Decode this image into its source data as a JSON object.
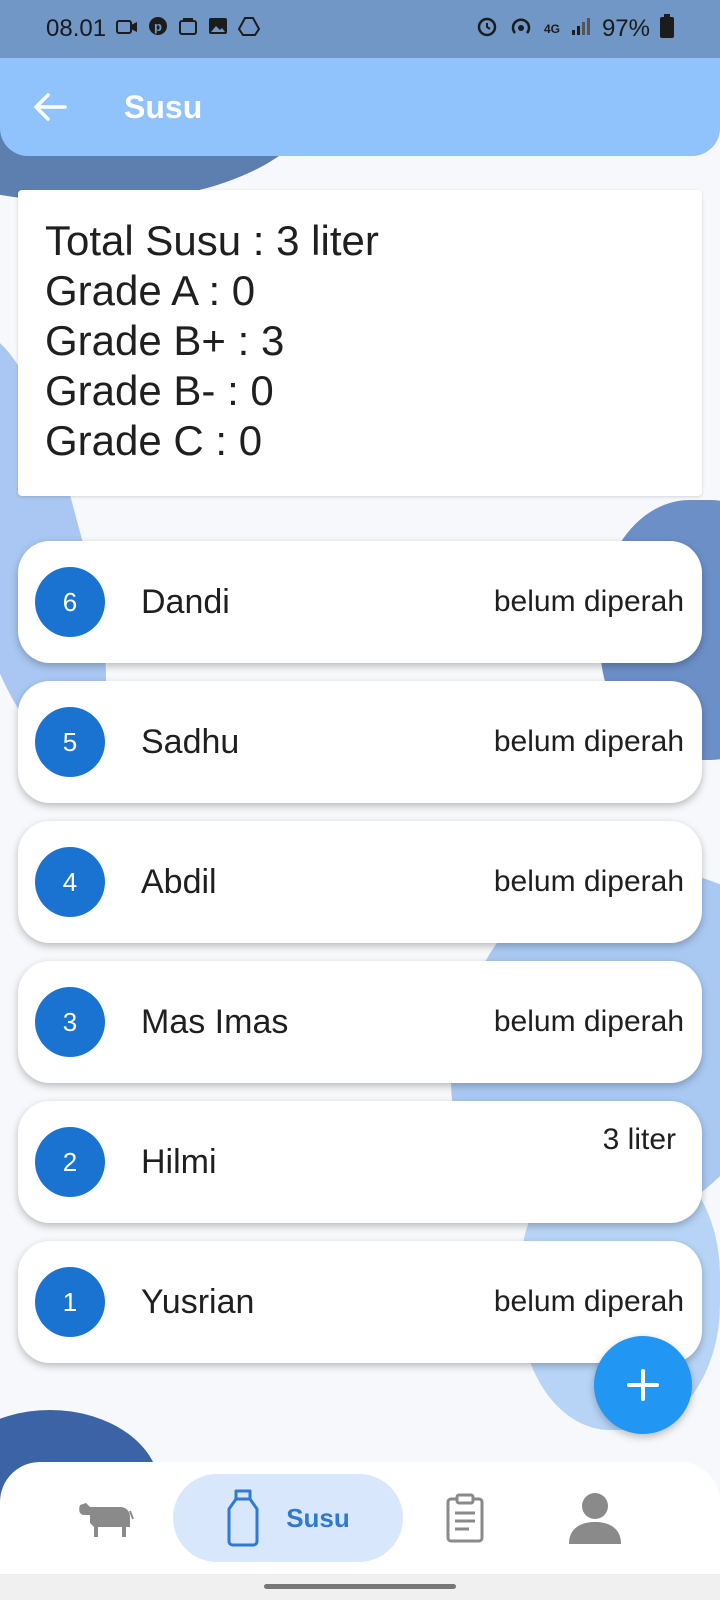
{
  "status_bar": {
    "time": "08.01",
    "battery": "97%",
    "network": "4G"
  },
  "app_bar": {
    "title": "Susu"
  },
  "summary": {
    "lines": [
      "Total Susu : 3 liter",
      "Grade A : 0",
      "Grade B+ : 3",
      "Grade B- : 0",
      "Grade C : 0"
    ]
  },
  "cows": [
    {
      "number": "6",
      "name": "Dandi",
      "status": "belum diperah"
    },
    {
      "number": "5",
      "name": "Sadhu",
      "status": "belum diperah"
    },
    {
      "number": "4",
      "name": "Abdil",
      "status": "belum diperah"
    },
    {
      "number": "3",
      "name": "Mas Imas",
      "status": "belum diperah"
    },
    {
      "number": "2",
      "name": "Hilmi",
      "status": "3 liter"
    },
    {
      "number": "1",
      "name": "Yusrian",
      "status": "belum diperah"
    }
  ],
  "bottom_nav": {
    "items": [
      {
        "icon": "cow-icon",
        "label": ""
      },
      {
        "icon": "milk-bottle-icon",
        "label": "Susu",
        "active": true
      },
      {
        "icon": "clipboard-icon",
        "label": ""
      },
      {
        "icon": "person-icon",
        "label": ""
      }
    ]
  },
  "colors": {
    "app_bar": "#90c3fb",
    "badge": "#1a73d0",
    "fab": "#2196f3",
    "nav_active_bg": "#d8e7fb",
    "nav_active_text": "#2f7ad1"
  }
}
